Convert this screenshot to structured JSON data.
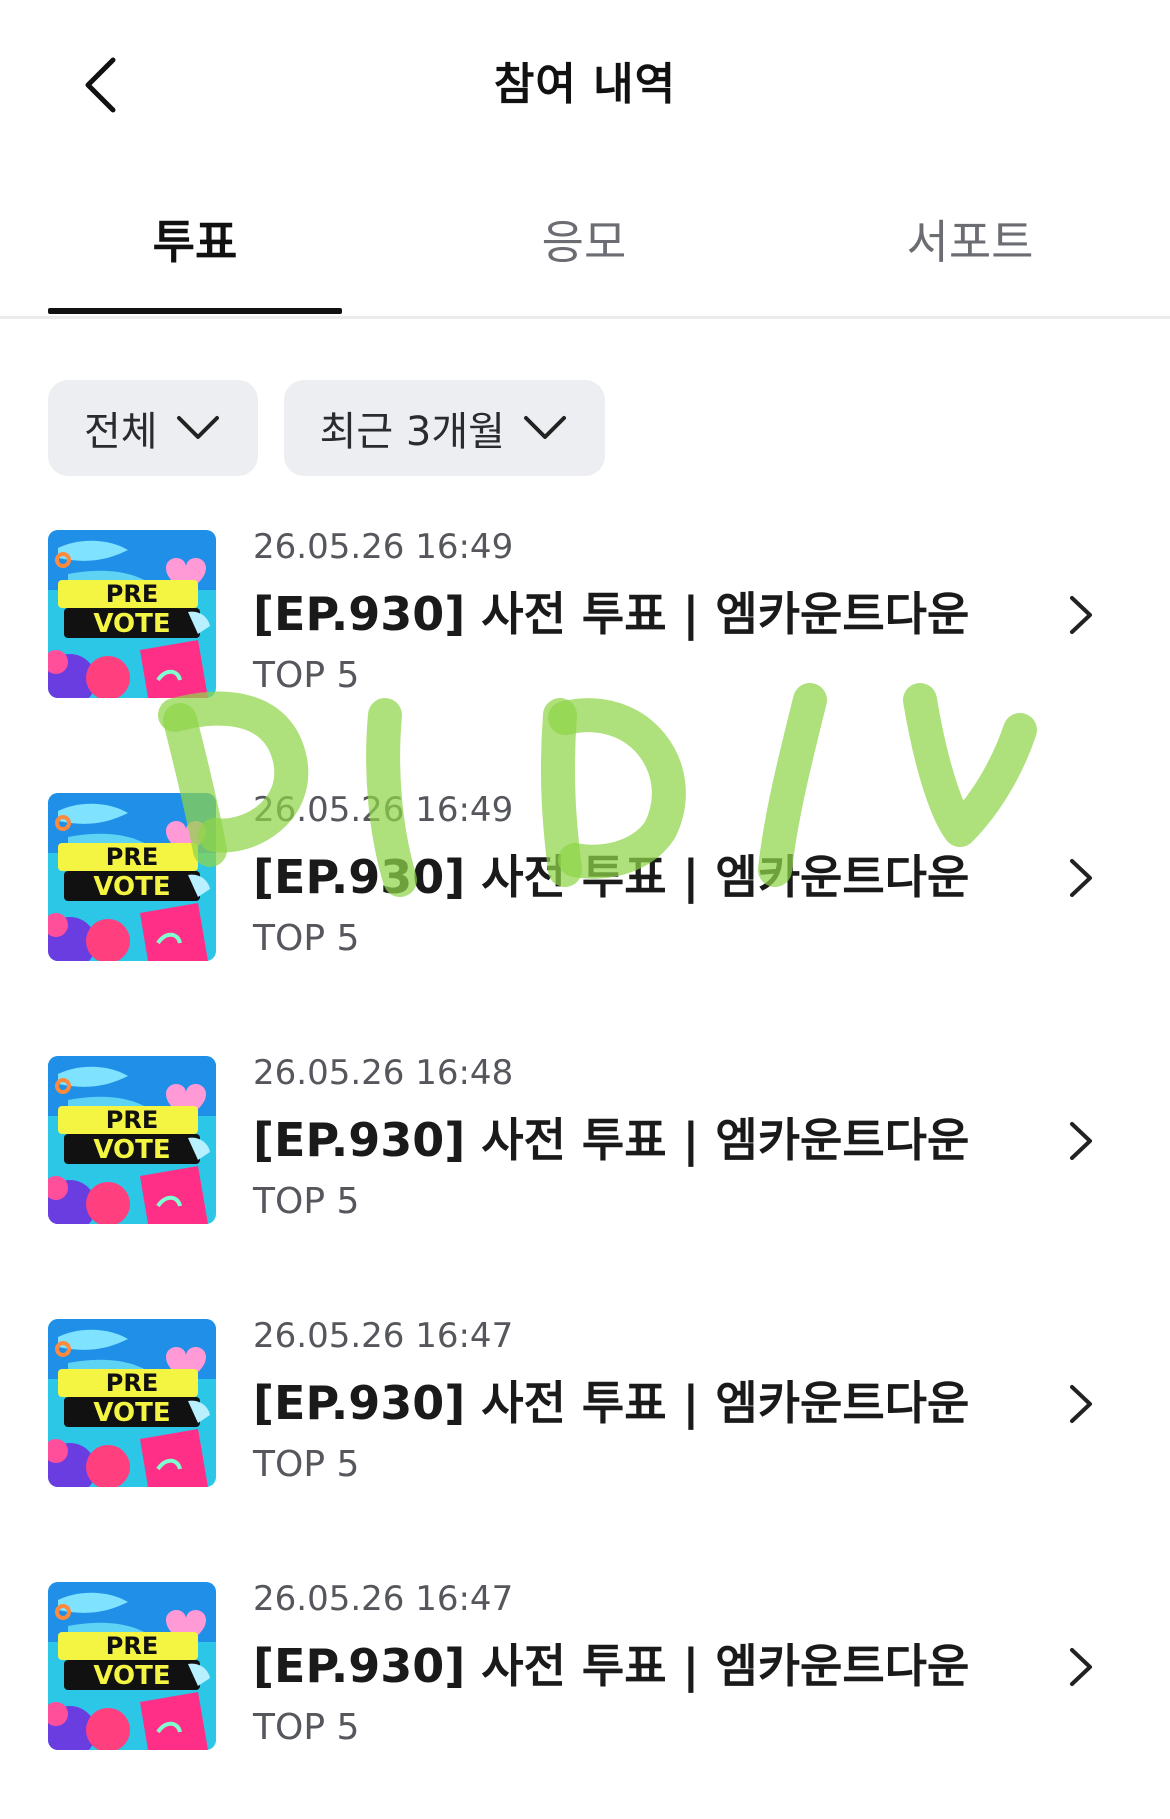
{
  "header": {
    "title": "참여 내역",
    "back_icon": "chevron-left-icon"
  },
  "tabs": [
    {
      "label": "투표",
      "active": true
    },
    {
      "label": "응모",
      "active": false
    },
    {
      "label": "서포트",
      "active": false
    }
  ],
  "filters": [
    {
      "label": "전체",
      "icon": "chevron-down-icon"
    },
    {
      "label": "최근 3개월",
      "icon": "chevron-down-icon"
    }
  ],
  "items": [
    {
      "date": "26.05.26 16:49",
      "title": "[EP.930] 사전 투표 | 엠카운트다운",
      "sub": "TOP 5",
      "thumb_line1": "PRE",
      "thumb_line2": "VOTE"
    },
    {
      "date": "26.05.26 16:49",
      "title": "[EP.930] 사전 투표 | 엠카운트다운",
      "sub": "TOP 5",
      "thumb_line1": "PRE",
      "thumb_line2": "VOTE"
    },
    {
      "date": "26.05.26 16:48",
      "title": "[EP.930] 사전 투표 | 엠카운트다운",
      "sub": "TOP 5",
      "thumb_line1": "PRE",
      "thumb_line2": "VOTE"
    },
    {
      "date": "26.05.26 16:47",
      "title": "[EP.930] 사전 투표 | 엠카운트다운",
      "sub": "TOP 5",
      "thumb_line1": "PRE",
      "thumb_line2": "VOTE"
    },
    {
      "date": "26.05.26 16:47",
      "title": "[EP.930] 사전 투표 | 엠카운트다운",
      "sub": "TOP 5",
      "thumb_line1": "PRE",
      "thumb_line2": "VOTE"
    }
  ],
  "colors": {
    "active_tab_underline": "#111111",
    "chip_background": "#eceef1",
    "watermark": "#8fd44a"
  }
}
